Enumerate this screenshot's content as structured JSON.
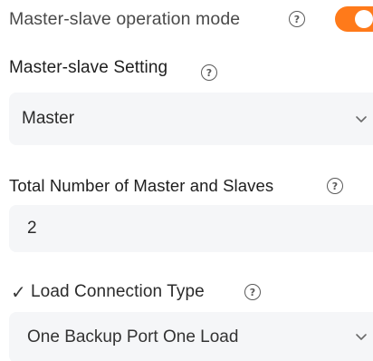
{
  "mode": {
    "label": "Master-slave operation mode",
    "help_icon": "?",
    "toggle_on": true,
    "accent_color": "#ff7a1a"
  },
  "setting": {
    "label": "Master-slave Setting",
    "help_icon": "?",
    "selected": "Master"
  },
  "total": {
    "label": "Total Number of Master and Slaves",
    "help_icon": "?",
    "value": "2"
  },
  "load_type": {
    "check_icon": "✓",
    "label": "Load Connection Type",
    "help_icon": "?",
    "selected": "One Backup Port One Load"
  }
}
